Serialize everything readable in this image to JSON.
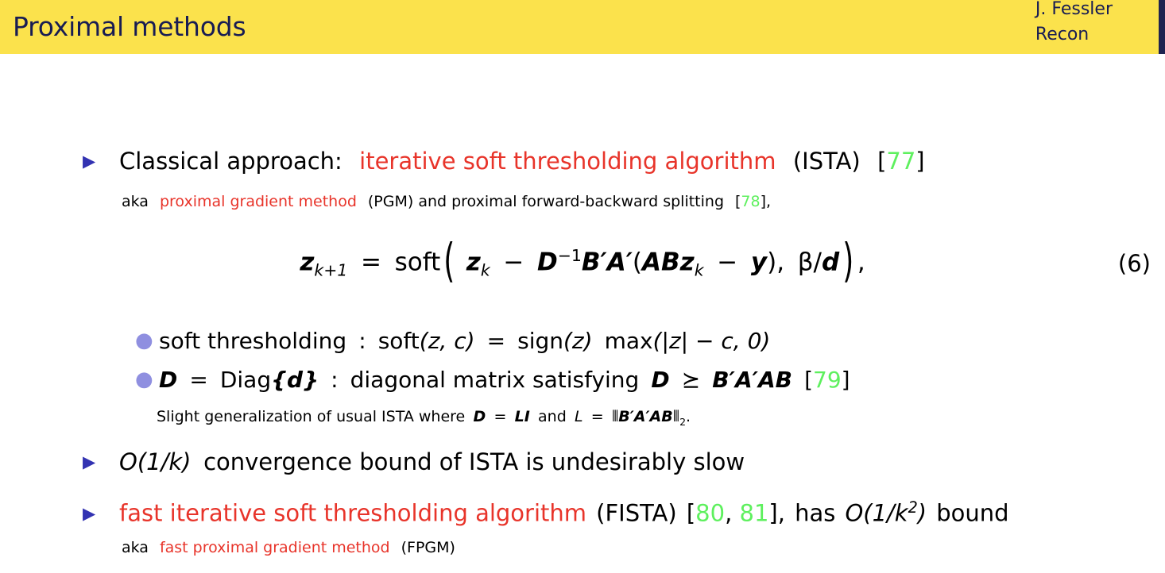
{
  "header": {
    "title": "Proximal methods",
    "author_line1": "J. Fessler",
    "author_line2": "Recon",
    "bar_color": "#fbe24c",
    "title_color": "#181c53",
    "edge_color": "#1f2350"
  },
  "colors": {
    "emphasis_red": "#e8342a",
    "citation_green": "#5ef05e",
    "bullet_triangle_blue": "#3333b2",
    "bullet_dot_periwinkle": "#8f8fe0",
    "body_text": "#000000"
  },
  "bullets": {
    "b1": {
      "lead": "Classical approach:",
      "emphasis": "iterative soft thresholding algorithm",
      "acronym": "(ISTA)",
      "cite_open": "[",
      "cite_num": "77",
      "cite_close": "]"
    },
    "b1_aka": {
      "aka": "aka",
      "emphasis": "proximal gradient method",
      "rest": "(PGM) and proximal forward-backward splitting",
      "cite_open": "[",
      "cite_num": "78",
      "cite_close": "],"
    },
    "b2": {
      "order": "O(1/k)",
      "rest": "convergence bound of ISTA is undesirably slow"
    },
    "b3": {
      "emphasis": "fast iterative soft thresholding algorithm",
      "acronym": "(FISTA)",
      "cite_open": "[",
      "cite_num_a": "80",
      "cite_sep": ", ",
      "cite_num_b": "81",
      "cite_close": "],",
      "tail_pre": "has",
      "order": "O(1/k",
      "order_sup": "2",
      "order_post": ")",
      "tail_post": "bound"
    },
    "b3_aka": {
      "aka": "aka",
      "emphasis": "fast proximal gradient method",
      "rest": "(FPGM)"
    }
  },
  "subbullets": {
    "s1": {
      "label": "soft thresholding",
      "colon": ":",
      "eq_lhs_fn": "soft",
      "eq_lhs_args": "(z, c)",
      "eq_eq": "=",
      "eq_rhs_fn1": "sign",
      "eq_rhs_arg1": "(z)",
      "eq_rhs_fn2": "max",
      "eq_rhs_arg2": "(|z| − c, 0)"
    },
    "s2": {
      "lhs": "D",
      "eq": "=",
      "fn": "Diag",
      "arg": "{d}",
      "colon": ":",
      "text": "diagonal matrix satisfying",
      "rel_lhs": "D",
      "rel": "⪰",
      "rel_rhs": "B′A′AB",
      "cite_open": "[",
      "cite_num": "79",
      "cite_close": "]"
    },
    "s2_note": {
      "pre": "Slight generalization of usual ISTA where",
      "eq1_lhs": "D",
      "eq1_eq": "=",
      "eq1_rhs": "LI",
      "mid": "and",
      "eq2_lhs": "L",
      "eq2_eq": "=",
      "eq2_norm_open": "⦀",
      "eq2_norm_body": "B′A′AB",
      "eq2_norm_close": "⦀",
      "eq2_sub": "2",
      "period": "."
    }
  },
  "equation": {
    "number": "(6)",
    "lhs_var": "z",
    "lhs_sub": "k+1",
    "eq": "=",
    "fn": "soft",
    "paren_open": "(",
    "t1_var": "z",
    "t1_sub": "k",
    "minus": "−",
    "t2_D": "D",
    "t2_D_sup": "−1",
    "t2_B": "B",
    "t2_Bp": "′",
    "t2_A": "A",
    "t2_Ap": "′",
    "inner_open": "(",
    "t3": "ABz",
    "t3_sub": "k",
    "minus2": "−",
    "t4": "y",
    "inner_close": ")",
    "comma": ",",
    "beta": "β",
    "slash": "/",
    "d": "d",
    "paren_close": ")",
    "trailing_comma": ","
  }
}
